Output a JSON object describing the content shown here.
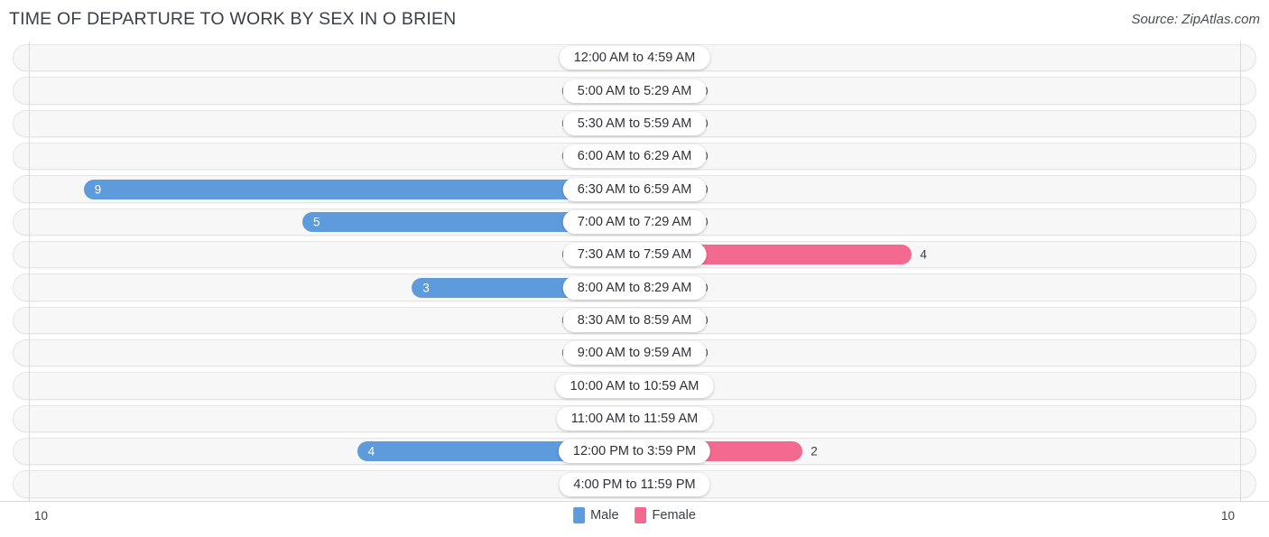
{
  "header": {
    "title": "TIME OF DEPARTURE TO WORK BY SEX IN O BRIEN",
    "source": "Source: ZipAtlas.com"
  },
  "footer": {
    "axis_max_left": "10",
    "axis_max_right": "10"
  },
  "legend": [
    {
      "label": "Male",
      "color": "#5e9bdd",
      "key": "male"
    },
    {
      "label": "Female",
      "color": "#f4698f",
      "key": "female"
    }
  ],
  "colors": {
    "male": "#5e9bdd",
    "male_zero": "#a8c8ea",
    "female": "#f4698f",
    "female_zero": "#f6afc6",
    "row_track": "#f7f7f7",
    "text": "#3c3f45"
  },
  "chart_data": {
    "type": "bar",
    "subtype": "diverging-horizontal-butterfly",
    "title": "TIME OF DEPARTURE TO WORK BY SEX IN O BRIEN",
    "xlabel": "",
    "ylabel": "",
    "xlim": [
      10,
      10
    ],
    "axis_max": 10,
    "grid": false,
    "legend_position": "bottom-center",
    "categories": [
      "12:00 AM to 4:59 AM",
      "5:00 AM to 5:29 AM",
      "5:30 AM to 5:59 AM",
      "6:00 AM to 6:29 AM",
      "6:30 AM to 6:59 AM",
      "7:00 AM to 7:29 AM",
      "7:30 AM to 7:59 AM",
      "8:00 AM to 8:29 AM",
      "8:30 AM to 8:59 AM",
      "9:00 AM to 9:59 AM",
      "10:00 AM to 10:59 AM",
      "11:00 AM to 11:59 AM",
      "12:00 PM to 3:59 PM",
      "4:00 PM to 11:59 PM"
    ],
    "series": [
      {
        "name": "Male",
        "side": "left",
        "color": "#5e9bdd",
        "values": [
          0,
          0,
          0,
          0,
          9,
          5,
          0,
          3,
          0,
          0,
          0,
          0,
          4,
          0
        ],
        "labels": [
          "0",
          "0",
          "0",
          "0",
          "9",
          "5",
          "0",
          "3",
          "0",
          "0",
          "0",
          "0",
          "4",
          "0"
        ]
      },
      {
        "name": "Female",
        "side": "right",
        "color": "#f4698f",
        "values": [
          0,
          0,
          0,
          0,
          0,
          0,
          4,
          0,
          0,
          0,
          0,
          0,
          2,
          0
        ],
        "labels": [
          "0",
          "0",
          "0",
          "0",
          "0",
          "0",
          "4",
          "0",
          "0",
          "0",
          "0",
          "0",
          "2",
          "0"
        ]
      }
    ]
  }
}
